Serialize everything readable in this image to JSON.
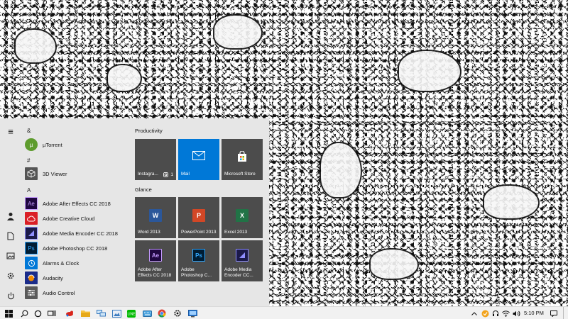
{
  "start_menu": {
    "rail": {
      "menu_icon": "≡"
    },
    "sections": {
      "amp": "&",
      "hash": "#",
      "a": "A"
    },
    "apps": {
      "utorrent": "µTorrent",
      "viewer3d": "3D Viewer",
      "after_effects": "Adobe After Effects CC 2018",
      "creative_cloud": "Adobe Creative Cloud",
      "media_encoder": "Adobe Media Encoder CC 2018",
      "photoshop": "Adobe Photoshop CC 2018",
      "alarms": "Alarms & Clock",
      "audacity": "Audacity",
      "audio_control": "Audio Control"
    },
    "groups": {
      "productivity": "Productivity",
      "glance": "Glance"
    },
    "tiles": {
      "instagram": "Instagra...",
      "instagram_badge": "1",
      "mail": "Mail",
      "store": "Microsoft Store",
      "word": "Word 2013",
      "powerpoint": "PowerPoint 2013",
      "excel": "Excel 2013",
      "after_effects": "Adobe After Effects CC 2018",
      "photoshop": "Adobe Photoshop C...",
      "media_encoder": "Adobe Media Encoder CC..."
    },
    "icon_glyphs": {
      "word": "W",
      "powerpoint": "P",
      "excel": "X",
      "ae": "Ae",
      "ps": "Ps",
      "me": "Me"
    }
  },
  "taskbar": {
    "clock_time": "5:10 PM",
    "accent": "#0078d7"
  }
}
